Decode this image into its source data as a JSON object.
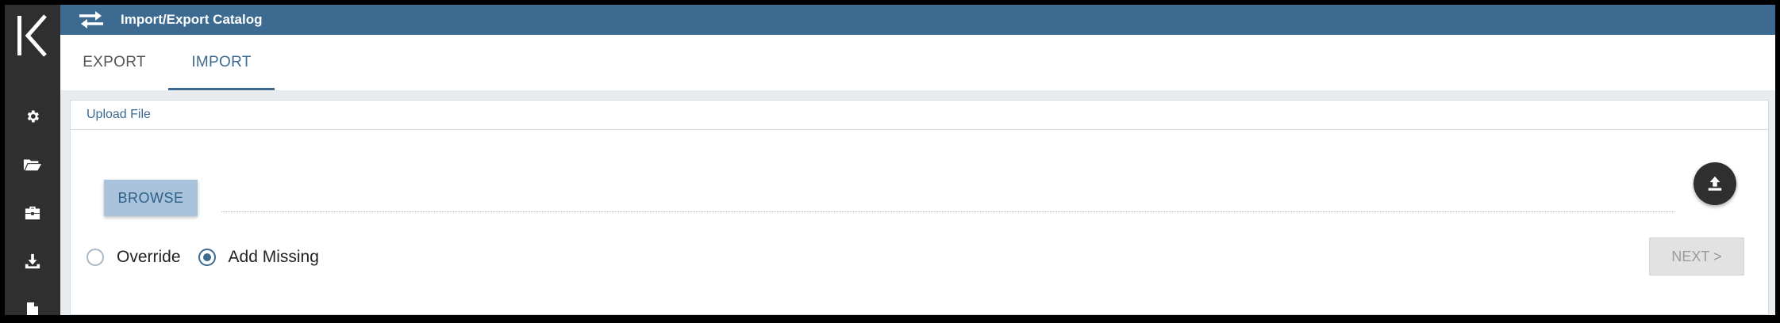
{
  "app": {
    "logo_letter": "K",
    "title": "Import/Export Catalog",
    "header_icon": "swap-arrows-icon"
  },
  "sidebar": {
    "items": [
      {
        "icon": "gear-icon"
      },
      {
        "icon": "folder-open-icon"
      },
      {
        "icon": "briefcase-icon"
      },
      {
        "icon": "download-icon"
      },
      {
        "icon": "document-icon"
      }
    ]
  },
  "tabs": [
    {
      "label": "EXPORT",
      "active": false
    },
    {
      "label": "IMPORT",
      "active": true
    }
  ],
  "upload": {
    "section_title": "Upload File",
    "browse_label": "BROWSE",
    "upload_icon": "upload-icon"
  },
  "options": {
    "override_label": "Override",
    "add_missing_label": "Add Missing",
    "selected": "Add Missing"
  },
  "actions": {
    "next_label": "NEXT >",
    "next_enabled": false
  },
  "colors": {
    "brand": "#3d6a91",
    "sidebar": "#2f2f2f",
    "browse_bg": "#a9c3dc"
  }
}
